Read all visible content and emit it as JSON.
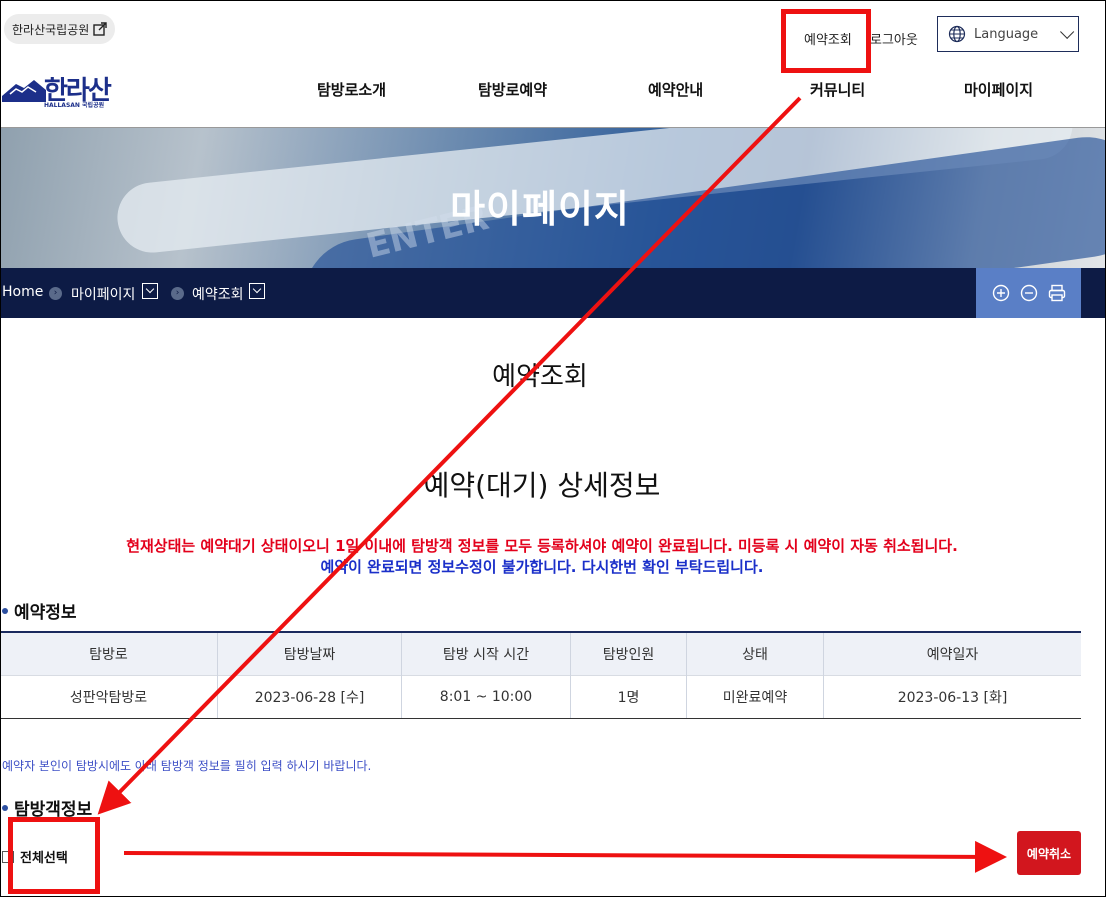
{
  "utility": {
    "park_link": "한라산국립공원",
    "reserve_check": "예약조회",
    "logout": "로그아웃",
    "language": "Language"
  },
  "logo": {
    "text": "한라산",
    "sub": "HALLASAN 국립공원"
  },
  "gnb": [
    "탐방로소개",
    "탐방로예약",
    "예약안내",
    "커뮤니티",
    "마이페이지"
  ],
  "banner": {
    "title": "마이페이지",
    "background_text": "ENTER"
  },
  "breadcrumb": [
    "Home",
    "마이페이지",
    "예약조회"
  ],
  "page": {
    "heading": "예약조회",
    "sub_heading": "예약(대기) 상세정보",
    "notice_red": "현재상태는 예약대기 상태이오니 1일 이내에 탐방객 정보를 모두 등록하셔야 예약이 완료됩니다. 미등록 시 예약이 자동 취소됩니다.",
    "notice_blue": "예약이 완료되면 정보수정이 불가합니다. 다시한번 확인 부탁드립니다."
  },
  "reservation": {
    "title": "예약정보",
    "columns": [
      "탐방로",
      "탐방날짜",
      "탐방 시작 시간",
      "탐방인원",
      "상태",
      "예약일자"
    ],
    "rows": [
      [
        "성판악탐방로",
        "2023-06-28 [수]",
        "8:01 ~ 10:00",
        "1명",
        "미완료예약",
        "2023-06-13 [화]"
      ]
    ]
  },
  "visitor": {
    "guide": "예약자 본인이 탐방시에도 아래 탐방객 정보를 필히 입력 하시기 바랍니다.",
    "title": "탐방객정보",
    "select_all": "전체선택",
    "cancel_button": "예약취소"
  },
  "colors": {
    "navy": "#0d1b45",
    "annotation_red": "#ee1111",
    "notice_red": "#e3001b",
    "notice_blue": "#1a2fc9",
    "cancel_red": "#d2161e"
  }
}
